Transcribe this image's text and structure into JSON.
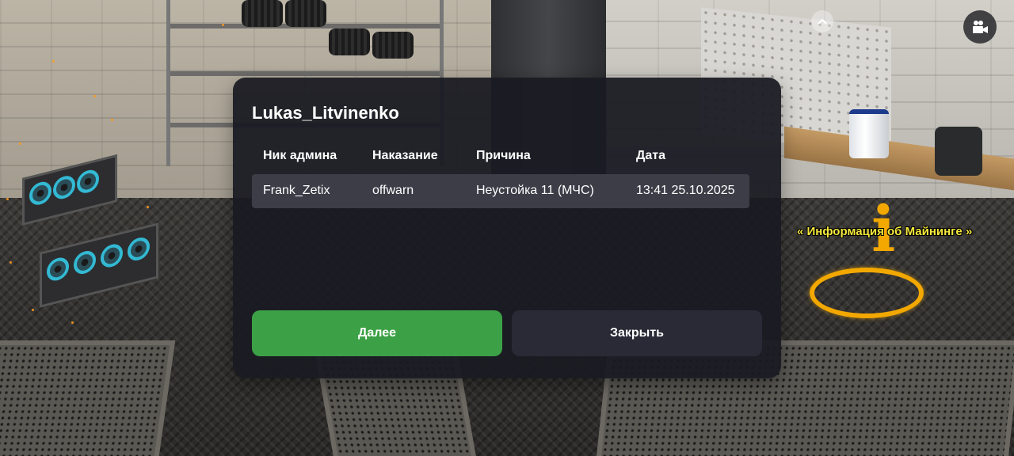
{
  "scene": {
    "mining_info_label": "« Информация об Майнинге »",
    "icons": [
      "info-marker-icon",
      "camera-icon",
      "chevron-up-icon"
    ]
  },
  "dialog": {
    "title": "Lukas_Litvinenko",
    "columns": [
      "Ник админа",
      "Наказание",
      "Причина",
      "Дата"
    ],
    "rows": [
      {
        "admin": "Frank_Zetix",
        "punishment": "offwarn",
        "reason": "Неустойка 11 (МЧС)",
        "date": "13:41 25.10.2025"
      }
    ],
    "buttons": {
      "next_label": "Далее",
      "close_label": "Закрыть"
    }
  },
  "colors": {
    "dialog_bg": "#1a1b22",
    "row_bg": "#3c3d47",
    "next_button": "#3ca146",
    "close_button": "#292a35",
    "info_label": "#f5e93c",
    "marker": "#f2a800"
  }
}
